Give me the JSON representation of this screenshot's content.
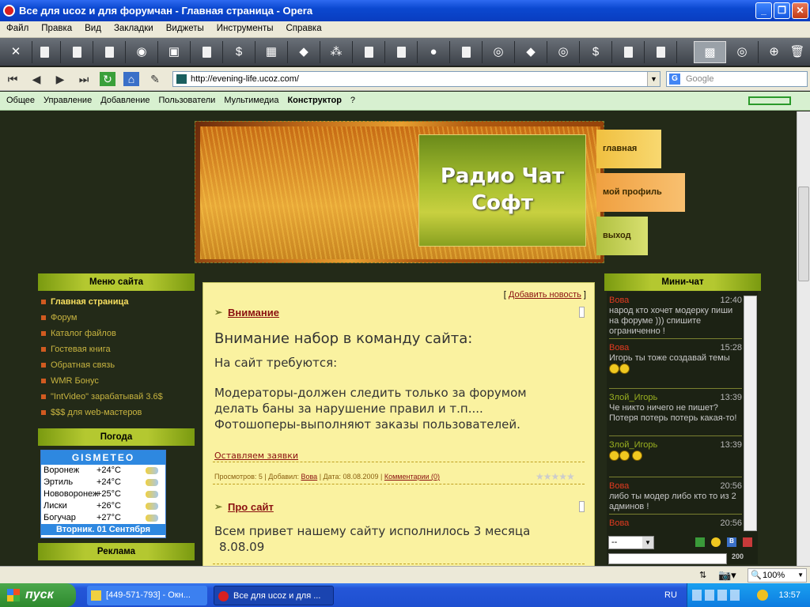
{
  "window": {
    "title": "Все для ucoz и для форумчан - Главная страница - Opera"
  },
  "menu": [
    "Файл",
    "Правка",
    "Вид",
    "Закладки",
    "Виджеты",
    "Инструменты",
    "Справка"
  ],
  "address": {
    "url": "http://evening-life.ucoz.com/",
    "search_placeholder": "Google"
  },
  "ucozbar": {
    "items": [
      "Общее",
      "Управление",
      "Добавление",
      "Пользователи",
      "Мультимедиа",
      "Конструктор",
      "?"
    ]
  },
  "header": {
    "title_line1": "Радио Чат",
    "title_line2": "Софт",
    "nav": [
      "главная",
      "мой профиль",
      "выход"
    ]
  },
  "left_menu": {
    "heading": "Меню сайта",
    "items": [
      "Главная страница",
      "Форум",
      "Каталог файлов",
      "Гостевая книга",
      "Обратная связь",
      "WMR Бонус",
      "\"IntVideo\" зарабатывай 3.6$",
      "$$$ для web-мастеров"
    ]
  },
  "weather": {
    "heading": "Погода",
    "brand": "GISMETEO",
    "rows": [
      {
        "city": "Воронеж",
        "temp": "+24°C"
      },
      {
        "city": "Эртиль",
        "temp": "+24°C"
      },
      {
        "city": "Нововоронеж",
        "temp": "+25°C"
      },
      {
        "city": "Лиски",
        "temp": "+26°C"
      },
      {
        "city": "Богучар",
        "temp": "+27°C"
      }
    ],
    "date": "Вторник. 01 Сентября"
  },
  "ads": {
    "heading": "Реклама"
  },
  "content": {
    "add_news": "Добавить новость",
    "post1": {
      "title": "Внимание",
      "headline": "Внимание набор в команду сайта:",
      "line1": "На сайт требуются:",
      "body1": "Модераторы-должен следить только за форумом",
      "body2": "делать баны за нарушение правил и т.п....",
      "body3": "Фотошоперы-выполняют заказы пользователей.",
      "link": "Оставляем заявки",
      "meta_views": "Просмотров: 5",
      "meta_added": "Добавил:",
      "meta_author": "Вова",
      "meta_date": "Дата: 08.08.2009",
      "meta_comments": "Комментарии (0)"
    },
    "post2": {
      "title": "Про сайт",
      "body1": "Всем привет нашему сайту  исполнилось 3 месяца",
      "body2": "8.08.09"
    }
  },
  "minichat": {
    "heading": "Мини-чат",
    "messages": [
      {
        "name": "Вова",
        "time": "12:40",
        "text": "народ кто хочет модерку пиши на форуме ))) спишите ограниченно !"
      },
      {
        "name": "Вова",
        "time": "15:28",
        "text": "Игорь ты тоже создавай темы"
      },
      {
        "name": "Злой_Игорь",
        "time": "13:39",
        "text": "Че никто ничего не пишет? Потеря потерь потерь какая-то!"
      },
      {
        "name": "Злой_Игорь",
        "time": "13:39",
        "text": ""
      },
      {
        "name": "Вова",
        "time": "20:56",
        "text": "либо ты модер либо кто то из 2 админов !"
      },
      {
        "name": "Вова",
        "time": "20:56",
        "text": ""
      }
    ],
    "select_value": "--",
    "counter": "200"
  },
  "status": {
    "zoom": "100%"
  },
  "taskbar": {
    "start": "пуск",
    "tasks": [
      "[449-571-793] - Окн...",
      "Все для ucoz и для ..."
    ],
    "lang": "RU",
    "clock": "13:57"
  }
}
